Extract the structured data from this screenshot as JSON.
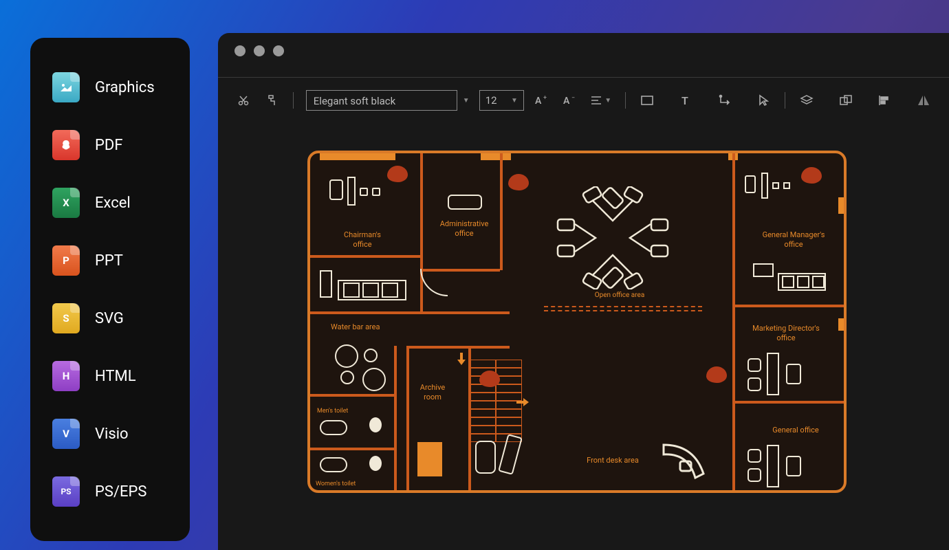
{
  "sidebar": {
    "items": [
      {
        "label": "Graphics",
        "icon": "graphics",
        "bg": "linear-gradient(180deg,#7dd6e0,#3aa8c4)"
      },
      {
        "label": "PDF",
        "icon": "pdf",
        "bg": "linear-gradient(180deg,#f26a5a,#d9362b)",
        "letter": "▸"
      },
      {
        "label": "Excel",
        "icon": "excel",
        "bg": "linear-gradient(180deg,#2fa360,#1a7a42)",
        "letter": "X"
      },
      {
        "label": "PPT",
        "icon": "ppt",
        "bg": "linear-gradient(180deg,#f07a4a,#d9531e)",
        "letter": "P"
      },
      {
        "label": "SVG",
        "icon": "svg",
        "bg": "linear-gradient(180deg,#f2c94c,#e0a920)",
        "letter": "S"
      },
      {
        "label": "HTML",
        "icon": "html",
        "bg": "linear-gradient(180deg,#b76be0,#8e3fc4)",
        "letter": "H"
      },
      {
        "label": "Visio",
        "icon": "visio",
        "bg": "linear-gradient(180deg,#4a7fe0,#2b5bc4)",
        "letter": "V"
      },
      {
        "label": "PS/EPS",
        "icon": "ps",
        "bg": "linear-gradient(180deg,#7a6be0,#5a3fc4)",
        "letter": "PS"
      }
    ]
  },
  "toolbar": {
    "theme_value": "Elegant soft black",
    "font_size": "12"
  },
  "floorplan": {
    "rooms": {
      "chairman": "Chairman's office",
      "admin": "Administrative office",
      "open_office": "Open office area",
      "gm": "General Manager's office",
      "water_bar": "Water bar area",
      "marketing": "Marketing Director's office",
      "archive": "Archive room",
      "mens_toilet": "Men's toilet",
      "womens_toilet": "Women's toilet",
      "front_desk": "Front desk area",
      "general_office": "General office"
    }
  }
}
